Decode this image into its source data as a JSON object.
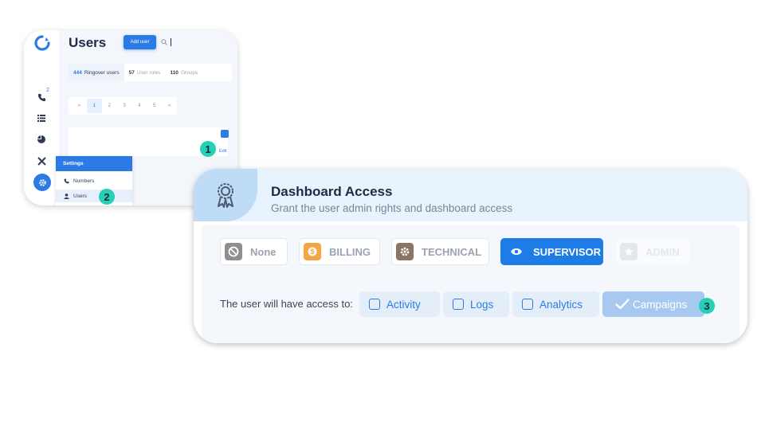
{
  "users_page": {
    "title": "Users",
    "add_user_label": "Add user",
    "search_placeholder": "",
    "sidebar": {
      "call_badge": "2"
    },
    "tabs": [
      {
        "count": "444",
        "label": "Ringover users"
      },
      {
        "count": "57",
        "label": "User roles"
      },
      {
        "count": "110",
        "label": "Groups"
      }
    ],
    "pagination": [
      "«",
      "1",
      "2",
      "3",
      "4",
      "5",
      "»"
    ],
    "edit_label": "Edit",
    "settings_menu": {
      "header": "Settings",
      "items": [
        "Numbers",
        "Users"
      ]
    }
  },
  "markers": [
    "1",
    "2",
    "3"
  ],
  "dashboard_access": {
    "title": "Dashboard Access",
    "subtitle": "Grant the user admin rights and dashboard access",
    "roles": [
      {
        "label": "None",
        "icon": "ban-icon",
        "color": "#8f8f8f"
      },
      {
        "label": "BILLING",
        "icon": "dollar-coin-icon",
        "color": "#f5a640"
      },
      {
        "label": "TECHNICAL",
        "icon": "gear-icon",
        "color": "#8b7466"
      },
      {
        "label": "SUPERVISOR",
        "icon": "eye-icon",
        "color": "#1e7ce6",
        "selected": true
      },
      {
        "label": "ADMIN",
        "icon": "star-icon",
        "color": "#e4e7ec"
      }
    ],
    "access_label": "The user will have access to:",
    "permissions": [
      {
        "label": "Activity",
        "checked": false
      },
      {
        "label": "Logs",
        "checked": false
      },
      {
        "label": "Analytics",
        "checked": false
      },
      {
        "label": "Campaigns",
        "checked": true
      }
    ]
  },
  "colors": {
    "accent": "#2c7be5",
    "marker": "#25d0b4"
  }
}
